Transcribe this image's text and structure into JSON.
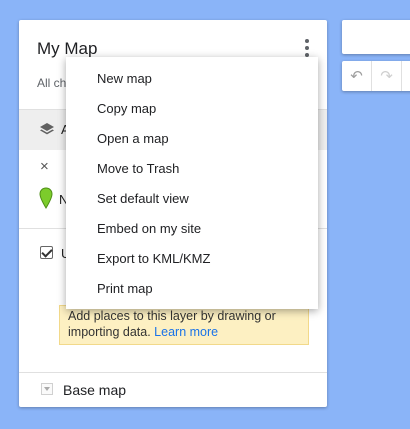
{
  "panel": {
    "title": "My Map",
    "subtitle": "All ch",
    "layer_label": "A",
    "close_icon": "×",
    "feature_label": "N",
    "layer_check_label": "U",
    "notice_text": "Add places to this layer by drawing or importing data.",
    "notice_link": "Learn more",
    "basemap_label": "Base map"
  },
  "icons": {
    "layers": "layers-icon",
    "pin": "map-pin-icon",
    "kebab": "more-vert-icon",
    "undo": "undo-icon",
    "redo": "redo-icon",
    "pin_color": "#7ccc2b"
  },
  "toolbar": {
    "undo": "↶",
    "redo": "↷"
  },
  "menu": {
    "items": [
      {
        "label": "New map"
      },
      {
        "label": "Copy map"
      },
      {
        "label": "Open a map"
      },
      {
        "label": "Move to Trash"
      },
      {
        "label": "Set default view"
      },
      {
        "label": "Embed on my site"
      },
      {
        "label": "Export to KML/KMZ"
      },
      {
        "label": "Print map"
      }
    ]
  }
}
